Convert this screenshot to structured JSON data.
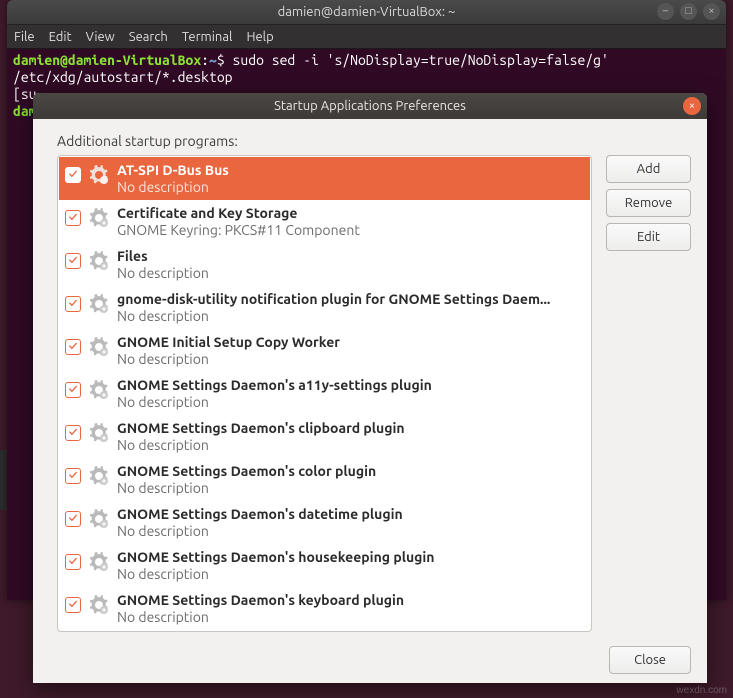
{
  "terminal": {
    "title": "damien@damien-VirtualBox: ~",
    "menu": [
      "File",
      "Edit",
      "View",
      "Search",
      "Terminal",
      "Help"
    ],
    "prompt_user": "damien@damien-VirtualBox",
    "prompt_colon": ":",
    "prompt_path": "~",
    "prompt_dollar": "$",
    "cmd": "sudo sed -i 's/NoDisplay=true/NoDisplay=false/g' /etc/xdg/autostart/*.desktop",
    "line2": "[su",
    "line3": "dam"
  },
  "dialog": {
    "title": "Startup Applications Preferences",
    "label": "Additional startup programs:",
    "buttons": {
      "add": "Add",
      "remove": "Remove",
      "edit": "Edit",
      "close": "Close"
    },
    "items": [
      {
        "name": "AT-SPI D-Bus Bus",
        "desc": "No description",
        "selected": true
      },
      {
        "name": "Certificate and Key Storage",
        "desc": "GNOME Keyring: PKCS#11 Component"
      },
      {
        "name": "Files",
        "desc": "No description"
      },
      {
        "name": "gnome-disk-utility notification plugin for GNOME Settings Daem...",
        "desc": "No description"
      },
      {
        "name": "GNOME Initial Setup Copy Worker",
        "desc": "No description"
      },
      {
        "name": "GNOME Settings Daemon's a11y-settings plugin",
        "desc": "No description"
      },
      {
        "name": "GNOME Settings Daemon's clipboard plugin",
        "desc": "No description"
      },
      {
        "name": "GNOME Settings Daemon's color plugin",
        "desc": "No description"
      },
      {
        "name": "GNOME Settings Daemon's datetime plugin",
        "desc": "No description"
      },
      {
        "name": "GNOME Settings Daemon's housekeeping plugin",
        "desc": "No description"
      },
      {
        "name": "GNOME Settings Daemon's keyboard plugin",
        "desc": "No description"
      }
    ]
  },
  "watermark": "wexdn.com"
}
